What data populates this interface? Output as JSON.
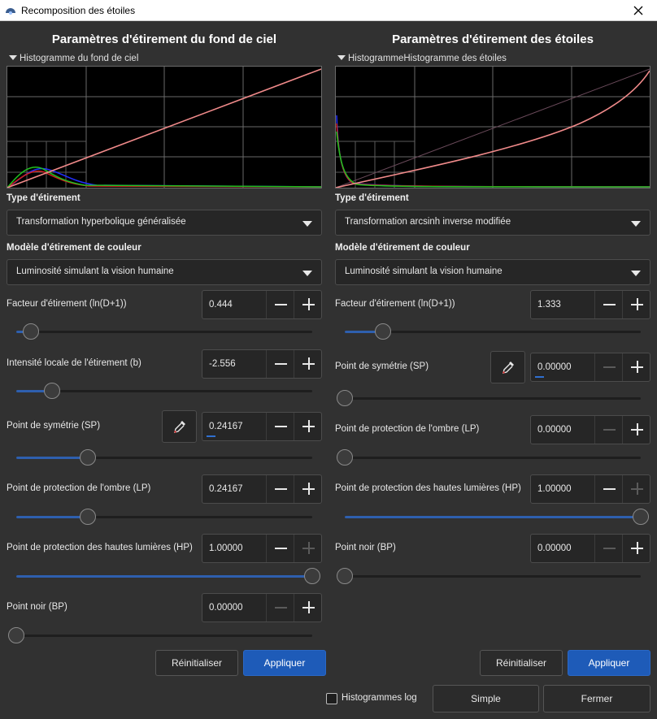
{
  "window": {
    "title": "Recomposition des étoiles"
  },
  "colors": {
    "accent": "#1e5bb8",
    "background": "#313131",
    "stretch_curve": "#f08a8a"
  },
  "left": {
    "title": "Paramètres d'étirement du fond de ciel",
    "histogram_label": "Histogramme du fond de ciel",
    "stretch_type_label": "Type d'étirement",
    "stretch_type_value": "Transformation hyperbolique généralisée",
    "color_model_label": "Modèle d'étirement de couleur",
    "color_model_value": "Luminosité simulant la vision humaine",
    "params": [
      {
        "label": "Facteur d'étirement (ln(D+1))",
        "value": "0.444",
        "slider": 0.05
      },
      {
        "label": "Intensité locale de l'étirement (b)",
        "value": "-2.556",
        "slider": 0.12
      },
      {
        "label": "Point de symétrie (SP)",
        "value": "0.24167",
        "slider": 0.24167
      },
      {
        "label": "Point de protection de l'ombre (LP)",
        "value": "0.24167",
        "slider": 0.24167
      },
      {
        "label": "Point de protection des hautes lumières (HP)",
        "value": "1.00000",
        "slider": 1.0
      },
      {
        "label": "Point noir (BP)",
        "value": "0.00000",
        "slider": 0.0
      }
    ],
    "reset_label": "Réinitialiser",
    "apply_label": "Appliquer"
  },
  "right": {
    "title": "Paramètres d'étirement des étoiles",
    "histogram_label": "HistogrammeHistogramme des étoiles",
    "stretch_type_label": "Type d'étirement",
    "stretch_type_value": "Transformation arcsinh inverse modifiée",
    "color_model_label": "Modèle d'étirement de couleur",
    "color_model_value": "Luminosité simulant la vision humaine",
    "params": [
      {
        "label": "Facteur d'étirement (ln(D+1))",
        "value": "1.333",
        "slider": 0.13
      },
      {
        "label": "Point de symétrie (SP)",
        "value": "0.00000",
        "slider": 0.0
      },
      {
        "label": "Point de protection de l'ombre (LP)",
        "value": "0.00000",
        "slider": 0.0
      },
      {
        "label": "Point de protection des hautes lumières (HP)",
        "value": "1.00000",
        "slider": 1.0
      },
      {
        "label": "Point noir (BP)",
        "value": "0.00000",
        "slider": 0.0
      }
    ],
    "reset_label": "Réinitialiser",
    "apply_label": "Appliquer"
  },
  "footer": {
    "log_hist_label": "Histogrammes log",
    "log_hist_checked": false,
    "simple_label": "Simple",
    "close_label": "Fermer"
  }
}
